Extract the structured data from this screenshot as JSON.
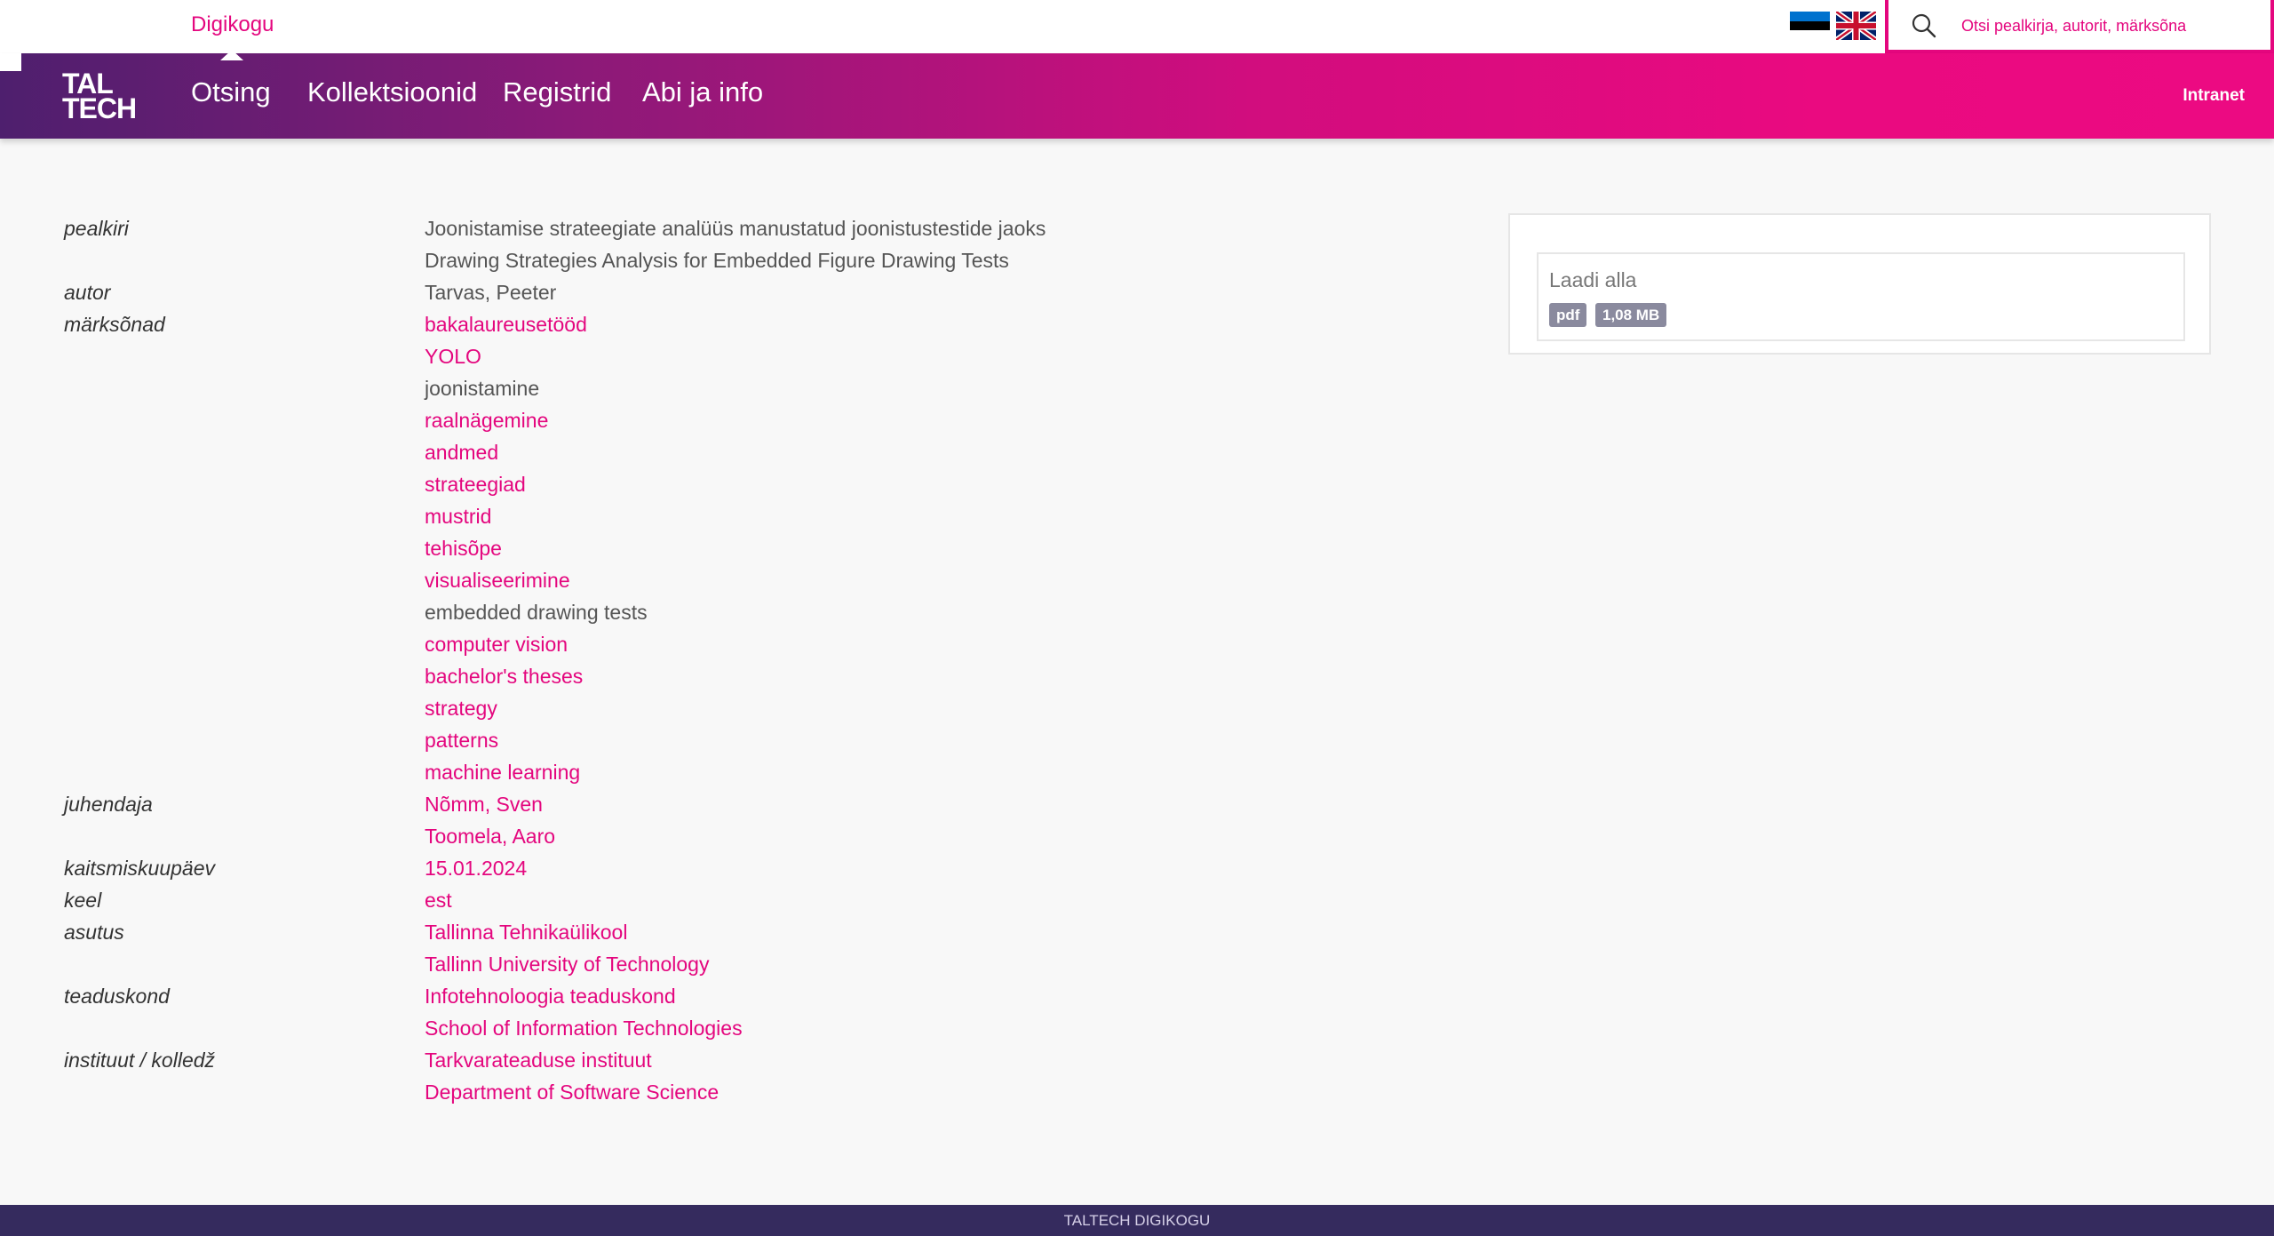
{
  "header": {
    "brand": "Digikogu",
    "logo_line1": "TAL",
    "logo_line2": "TECH",
    "search_placeholder": "Otsi pealkirja, autorit, märksõna",
    "intranet": "Intranet",
    "nav": [
      "Otsing",
      "Kollektsioonid",
      "Registrid",
      "Abi ja info"
    ],
    "languages": [
      "Eesti",
      "English"
    ]
  },
  "record": {
    "labels": {
      "title": "pealkiri",
      "author": "autor",
      "keywords": "märksõnad",
      "supervisor": "juhendaja",
      "defense_date": "kaitsmiskuupäev",
      "language": "keel",
      "institution": "asutus",
      "faculty": "teaduskond",
      "institute": "instituut / kolledž"
    },
    "title": [
      "Joonistamise strateegiate analüüs manustatud joonistustestide jaoks",
      "Drawing Strategies Analysis for Embedded Figure Drawing Tests"
    ],
    "author": "Tarvas, Peeter",
    "keywords": [
      "bakalaureusetööd",
      "YOLO",
      "joonistamine",
      "raalnägemine",
      "andmed",
      "strateegiad",
      "mustrid",
      "tehisõpe",
      "visualiseerimine",
      "embedded drawing tests",
      "computer vision",
      "bachelor's theses",
      "strategy",
      "patterns",
      "machine learning"
    ],
    "supervisors": [
      "Nõmm, Sven",
      "Toomela, Aaro"
    ],
    "defense_date": "15.01.2024",
    "language": "est",
    "institution": [
      "Tallinna Tehnikaülikool",
      "Tallinn University of Technology"
    ],
    "faculty": [
      "Infotehnoloogia teaduskond",
      "School of Information Technologies"
    ],
    "institute": [
      "Tarkvarateaduse instituut",
      "Department of Software Science"
    ]
  },
  "download": {
    "title": "Laadi alla",
    "format": "pdf",
    "size": "1,08 MB"
  },
  "footer": {
    "text": "TALTECH DIGIKOGU"
  },
  "colors": {
    "accent": "#e4067e",
    "nav_start": "#4e1f6e",
    "footer": "#352b5e"
  }
}
